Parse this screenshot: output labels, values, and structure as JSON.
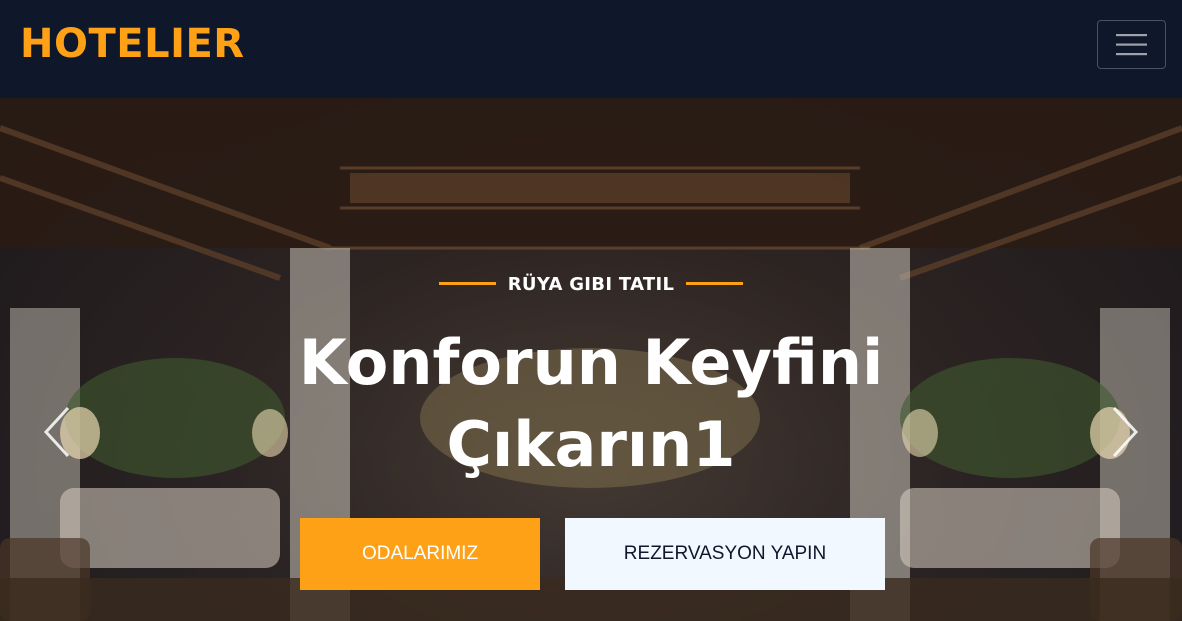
{
  "brand": {
    "name": "HOTELIER",
    "color": "#fea116"
  },
  "navbar": {
    "toggler_icon": "hamburger-icon",
    "background": "#0f172b"
  },
  "hero": {
    "subtitle": "RÜYA GIBI TATIL",
    "headline_line1": "Konforun Keyfini",
    "headline_line2": "Çıkarın1",
    "buttons": {
      "primary": "ODALARIMIZ",
      "secondary": "REZERVASYON YAPIN"
    },
    "prev_icon": "chevron-left-icon",
    "next_icon": "chevron-right-icon"
  }
}
